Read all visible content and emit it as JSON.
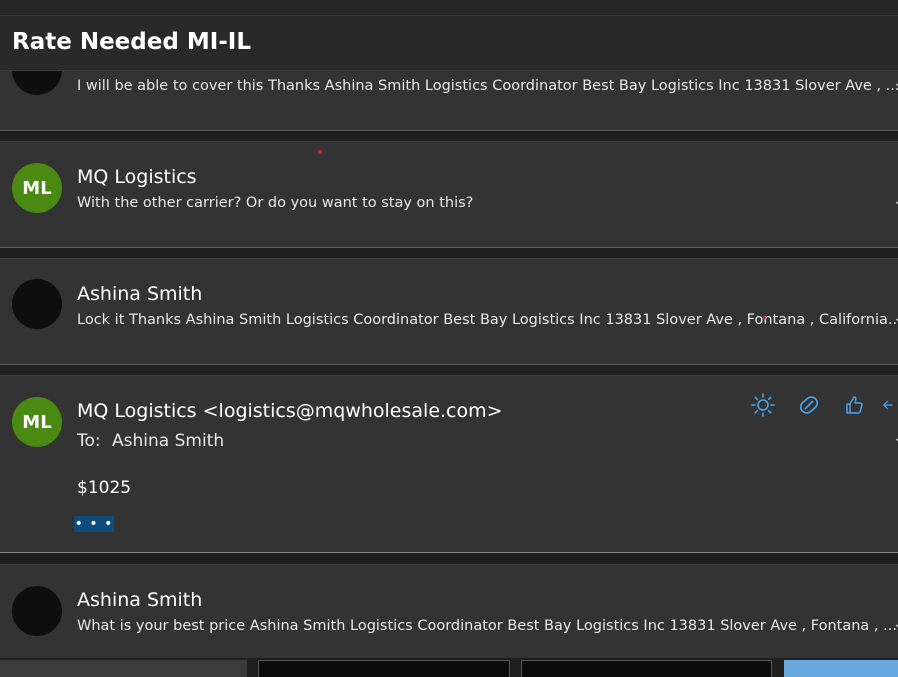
{
  "thread": {
    "subject": "Rate Needed MI-IL"
  },
  "messages": [
    {
      "sender": "",
      "avatar_initials": "",
      "preview": "I will be able to cover this Thanks Ashina Smith Logistics Coordinator Best Bay Logistics Inc 13831 Slover Ave , ..."
    },
    {
      "sender": "MQ Logistics",
      "avatar_initials": "ML",
      "preview": "With the other carrier? Or do you want to stay on this?"
    },
    {
      "sender": "Ashina Smith",
      "avatar_initials": "",
      "preview": "Lock it Thanks Ashina Smith Logistics Coordinator Best Bay Logistics Inc 13831 Slover Ave , Fontana , California..."
    },
    {
      "sender": "MQ Logistics <logistics@mqwholesale.com>",
      "avatar_initials": "ML",
      "to_label": "To:",
      "to_value": "Ashina Smith",
      "body": "$1025",
      "more_label": "• • •"
    },
    {
      "sender": "Ashina Smith",
      "avatar_initials": "",
      "preview": "What is your best price Ashina Smith Logistics Coordinator Best Bay Logistics Inc 13831 Slover Ave , Fontana , ..."
    }
  ],
  "edge_glyph": "⌄",
  "actions": [
    {
      "name": "sun-icon"
    },
    {
      "name": "loop-icon"
    },
    {
      "name": "thumbs-up-icon"
    },
    {
      "name": "reply-icon"
    }
  ],
  "colors": {
    "accent": "#4aa3f0",
    "avatar_green": "#4a8a12",
    "card_bg": "#333333"
  }
}
